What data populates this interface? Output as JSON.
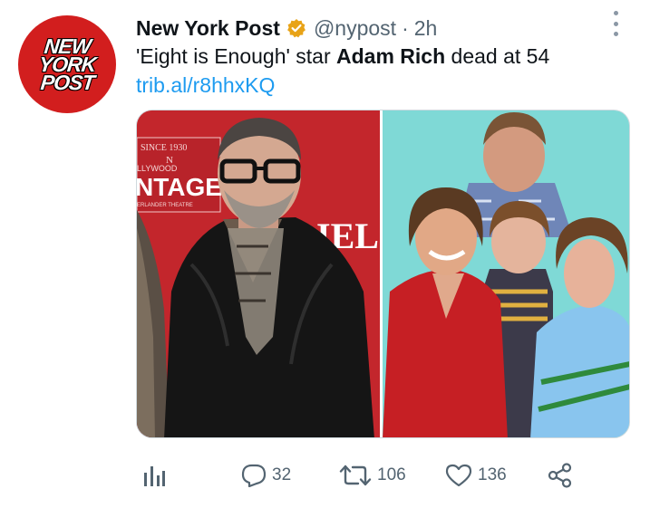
{
  "tweet": {
    "author": {
      "name": "New York Post",
      "handle": "@nypost",
      "time": "2h",
      "avatar_logo_lines": [
        "NEW",
        "YORK",
        "POST"
      ],
      "avatar_color": "#d21e1e"
    },
    "text_before": "'Eight is Enough' star ",
    "text_bold": "Adam Rich",
    "text_after": " dead at 54",
    "link": "trib.al/r8hhxKQ",
    "media": {
      "left_photo": {
        "icon": "person-photo-portrait",
        "background_color": "#c92a2f",
        "sign_lines": [
          "SINCE 1930",
          "N",
          "LLYWOOD",
          "NTAGE",
          "ERLANDER THEATRE"
        ],
        "side_sign": "IEL"
      },
      "right_photo": {
        "icon": "group-photo-cast",
        "background_color": "#7fd9d6"
      }
    }
  },
  "actions": {
    "analytics_icon": "analytics-icon",
    "reply_count": "32",
    "retweet_count": "106",
    "like_count": "136",
    "share_icon": "share-icon"
  },
  "colors": {
    "link": "#1d9bf0",
    "secondary_text": "#536471",
    "verified_badge": "#e8a317"
  }
}
